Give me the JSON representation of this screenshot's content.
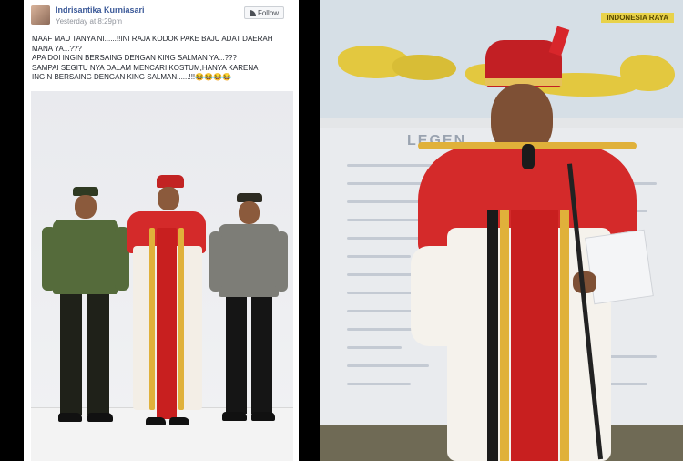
{
  "post": {
    "author": "Indrisantika Kurniasari",
    "timestamp": "Yesterday at 8:29pm",
    "follow_label": "Follow",
    "caption": [
      "MAAF MAU TANYA NI......!!INI RAJA KODOK PAKE BAJU ADAT DAERAH",
      "MANA YA...???",
      "APA DOI INGIN BERSAING DENGAN KING SALMAN YA...???",
      "SAMPAI SEGITU NYA DALAM MENCARI KOSTUM,HANYA KARENA",
      "INGIN BERSAING DENGAN KING SALMAN......!!!😂😂😂😂"
    ]
  },
  "photo_right": {
    "map_label": "INDONESIA RAYA",
    "board_title": "LEGEN"
  },
  "colors": {
    "link_blue": "#3b5998",
    "costume_red": "#d42a2a",
    "gold": "#e0b13a",
    "military_green": "#556b3b",
    "police_khaki": "#7d7d77"
  }
}
